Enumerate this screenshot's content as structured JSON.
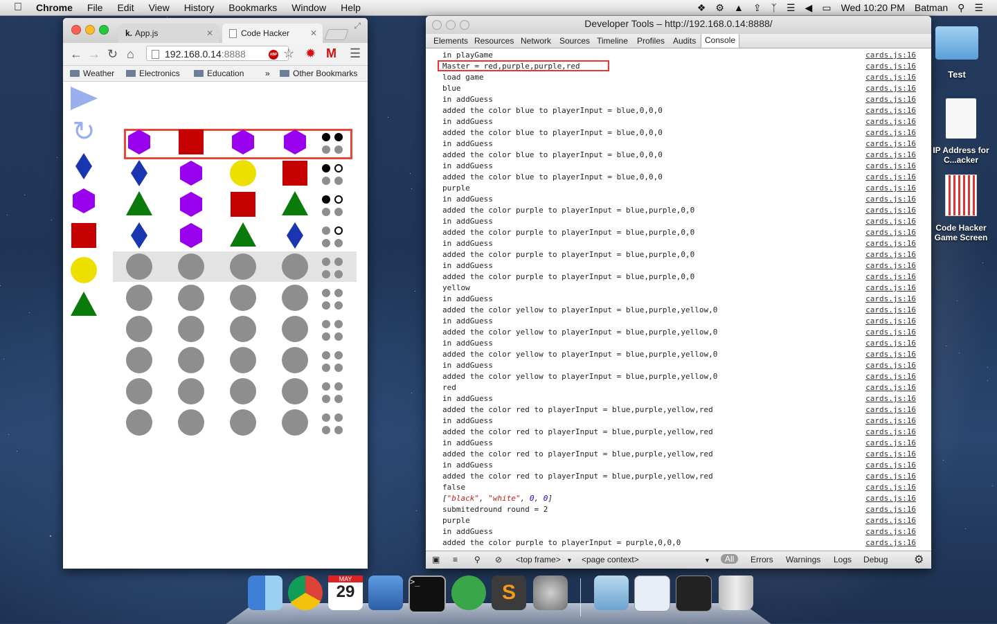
{
  "menubar": {
    "app": "Chrome",
    "items": [
      "File",
      "Edit",
      "View",
      "History",
      "Bookmarks",
      "Window",
      "Help"
    ],
    "clock": "Wed 10:20 PM",
    "user": "Batman"
  },
  "chrome": {
    "tabs": [
      {
        "label": "App.js",
        "active": false
      },
      {
        "label": "Code Hacker",
        "active": true
      }
    ],
    "url_host": "192.168.0.14",
    "url_port": ":8888",
    "bookmarks": [
      "Weather",
      "Electronics",
      "Education",
      "»",
      "Other Bookmarks"
    ],
    "abp_badge": "ABP"
  },
  "game": {
    "palette": [
      "play",
      "refresh",
      "blue-diamond",
      "purple-hexagon",
      "red-square",
      "yellow-circle",
      "green-triangle"
    ],
    "master_code": [
      "purple-hexagon",
      "red-square",
      "purple-hexagon",
      "purple-hexagon"
    ],
    "master_pegs": [
      "black",
      "black",
      "gray",
      "gray"
    ],
    "rows": [
      {
        "pieces": [
          "blue-diamond",
          "purple-hexagon",
          "yellow-circle",
          "red-square"
        ],
        "pegs": [
          "black",
          "white",
          "gray",
          "gray"
        ]
      },
      {
        "pieces": [
          "green-triangle",
          "purple-hexagon",
          "red-square",
          "green-triangle"
        ],
        "pegs": [
          "black",
          "white",
          "gray",
          "gray"
        ]
      },
      {
        "pieces": [
          "blue-diamond",
          "purple-hexagon",
          "green-triangle",
          "blue-diamond"
        ],
        "pegs": [
          "gray",
          "white",
          "gray",
          "gray"
        ]
      },
      {
        "pieces": [
          "empty",
          "empty",
          "empty",
          "empty"
        ],
        "pegs": [
          "gray",
          "gray",
          "gray",
          "gray"
        ],
        "active": true
      },
      {
        "pieces": [
          "empty",
          "empty",
          "empty",
          "empty"
        ],
        "pegs": [
          "gray",
          "gray",
          "gray",
          "gray"
        ]
      },
      {
        "pieces": [
          "empty",
          "empty",
          "empty",
          "empty"
        ],
        "pegs": [
          "gray",
          "gray",
          "gray",
          "gray"
        ]
      },
      {
        "pieces": [
          "empty",
          "empty",
          "empty",
          "empty"
        ],
        "pegs": [
          "gray",
          "gray",
          "gray",
          "gray"
        ]
      },
      {
        "pieces": [
          "empty",
          "empty",
          "empty",
          "empty"
        ],
        "pegs": [
          "gray",
          "gray",
          "gray",
          "gray"
        ]
      },
      {
        "pieces": [
          "empty",
          "empty",
          "empty",
          "empty"
        ],
        "pegs": [
          "gray",
          "gray",
          "gray",
          "gray"
        ]
      }
    ],
    "colors": {
      "blue": "#1a35b0",
      "purple": "#9900ee",
      "yellow": "#ede000",
      "red": "#c40000",
      "green": "#0a7a0a",
      "empty": "#8e8e8e",
      "highlight": "#e8473a"
    }
  },
  "devtools": {
    "title": "Developer Tools – http://192.168.0.14:8888/",
    "tabs": [
      "Elements",
      "Resources",
      "Network",
      "Sources",
      "Timeline",
      "Profiles",
      "Audits",
      "Console"
    ],
    "active_tab": "Console",
    "source": "cards.js:16",
    "console": [
      "in playGame",
      "Master = red,purple,purple,red",
      "load game",
      "blue",
      "in addGuess",
      "added the color blue to playerInput = blue,0,0,0",
      "in addGuess",
      "added the color blue to playerInput = blue,0,0,0",
      "in addGuess",
      "added the color blue to playerInput = blue,0,0,0",
      "in addGuess",
      "added the color blue to playerInput = blue,0,0,0",
      "purple",
      "in addGuess",
      "added the color purple to playerInput = blue,purple,0,0",
      "in addGuess",
      "added the color purple to playerInput = blue,purple,0,0",
      "in addGuess",
      "added the color purple to playerInput = blue,purple,0,0",
      "in addGuess",
      "added the color purple to playerInput = blue,purple,0,0",
      "yellow",
      "in addGuess",
      "added the color yellow to playerInput = blue,purple,yellow,0",
      "in addGuess",
      "added the color yellow to playerInput = blue,purple,yellow,0",
      "in addGuess",
      "added the color yellow to playerInput = blue,purple,yellow,0",
      "in addGuess",
      "added the color yellow to playerInput = blue,purple,yellow,0",
      "red",
      "in addGuess",
      "added the color red to playerInput = blue,purple,yellow,red",
      "in addGuess",
      "added the color red to playerInput = blue,purple,yellow,red",
      "in addGuess",
      "added the color red to playerInput = blue,purple,yellow,red",
      "in addGuess",
      "added the color red to playerInput = blue,purple,yellow,red",
      "false",
      "ARRAY",
      "submitedround round = 2",
      "purple",
      "in addGuess",
      "added the color purple to playerInput = purple,0,0,0"
    ],
    "array_line": {
      "open": "[",
      "s1": "\"black\"",
      "sep": ", ",
      "s2": "\"white\"",
      "n1": "0",
      "n2": "0",
      "close": "]"
    },
    "status": {
      "frame": "<top frame>",
      "context": "<page context>",
      "filters": [
        "All",
        "Errors",
        "Warnings",
        "Logs",
        "Debug"
      ]
    }
  },
  "desktop": {
    "icons": [
      "Test",
      "IP Address for C...acker",
      "Code Hacker Game Screen"
    ]
  },
  "dock": {
    "apps": [
      "finder",
      "chrome",
      "calendar",
      "xcode",
      "terminal",
      "adium",
      "sublime",
      "system-preferences",
      "folder",
      "preview",
      "terminal-window",
      "trash"
    ],
    "calendar_month": "MAY",
    "calendar_day": "29"
  }
}
